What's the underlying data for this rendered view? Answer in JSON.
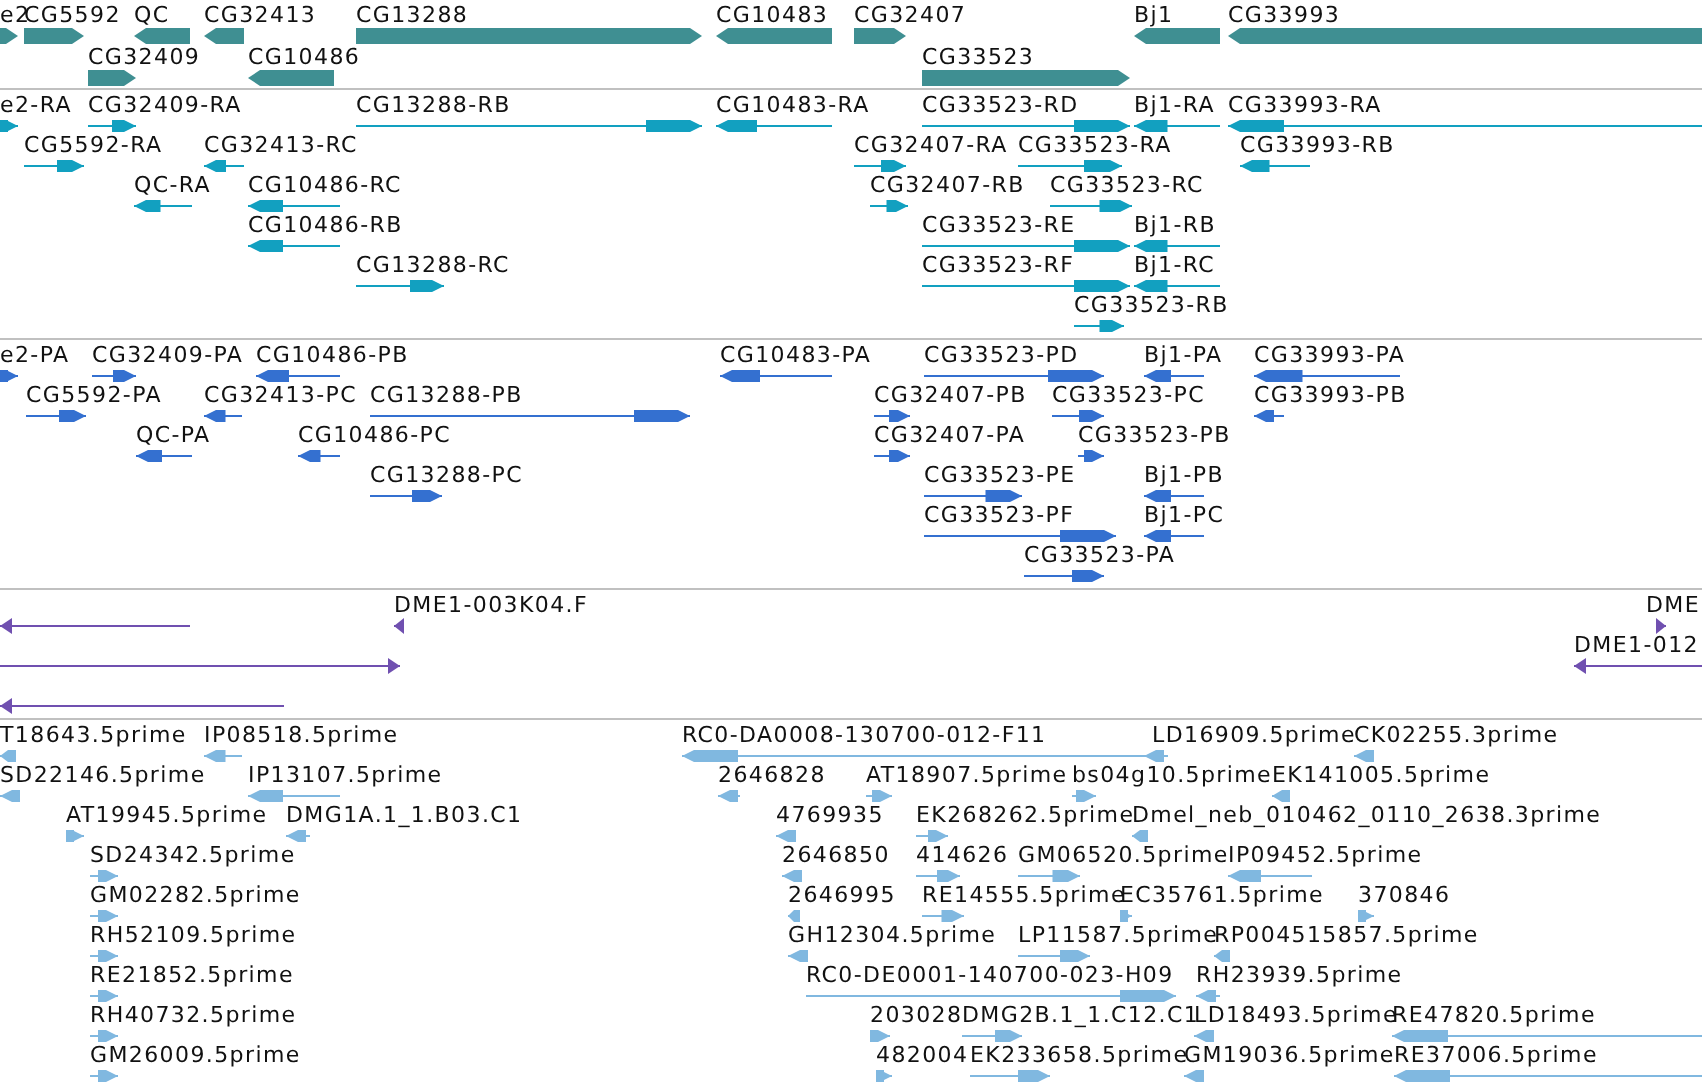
{
  "tracks": [
    {
      "kind": "gene",
      "color": "#3f8f92",
      "features": [
        {
          "label": "e2",
          "reverse": false
        },
        {
          "label": "CG5592",
          "reverse": false
        },
        {
          "label": "QC",
          "reverse": true
        },
        {
          "label": "CG32413",
          "reverse": true
        },
        {
          "label": "CG13288",
          "reverse": false
        },
        {
          "label": "CG10483",
          "reverse": true
        },
        {
          "label": "CG32407",
          "reverse": false
        },
        {
          "label": "Bj1",
          "reverse": true
        },
        {
          "label": "CG33993",
          "reverse": true
        },
        {
          "label": "CG32409",
          "reverse": false
        },
        {
          "label": "CG10486",
          "reverse": true
        },
        {
          "label": "CG33523",
          "reverse": false
        }
      ]
    },
    {
      "kind": "transcript",
      "color": "#12a0c0",
      "features": [
        {
          "label": "e2-RA",
          "reverse": false
        },
        {
          "label": "CG32409-RA",
          "reverse": false
        },
        {
          "label": "CG13288-RB",
          "reverse": false
        },
        {
          "label": "CG10483-RA",
          "reverse": true
        },
        {
          "label": "CG33523-RD",
          "reverse": false
        },
        {
          "label": "Bj1-RA",
          "reverse": true
        },
        {
          "label": "CG33993-RA",
          "reverse": true
        },
        {
          "label": "CG5592-RA",
          "reverse": false
        },
        {
          "label": "CG32413-RC",
          "reverse": true
        },
        {
          "label": "CG32407-RA",
          "reverse": false
        },
        {
          "label": "CG33523-RA",
          "reverse": false
        },
        {
          "label": "CG33993-RB",
          "reverse": true
        },
        {
          "label": "QC-RA",
          "reverse": true
        },
        {
          "label": "CG10486-RC",
          "reverse": true
        },
        {
          "label": "CG32407-RB",
          "reverse": false
        },
        {
          "label": "CG33523-RC",
          "reverse": false
        },
        {
          "label": "CG10486-RB",
          "reverse": true
        },
        {
          "label": "CG33523-RE",
          "reverse": false
        },
        {
          "label": "Bj1-RB",
          "reverse": true
        },
        {
          "label": "CG13288-RC",
          "reverse": false
        },
        {
          "label": "CG33523-RF",
          "reverse": false
        },
        {
          "label": "Bj1-RC",
          "reverse": true
        },
        {
          "label": "CG33523-RB",
          "reverse": false
        }
      ]
    },
    {
      "kind": "transcript",
      "color": "#3470d0",
      "features": [
        {
          "label": "e2-PA",
          "reverse": false
        },
        {
          "label": "CG32409-PA",
          "reverse": false
        },
        {
          "label": "CG10486-PB",
          "reverse": true
        },
        {
          "label": "CG10483-PA",
          "reverse": true
        },
        {
          "label": "CG33523-PD",
          "reverse": false
        },
        {
          "label": "Bj1-PA",
          "reverse": true
        },
        {
          "label": "CG33993-PA",
          "reverse": true
        },
        {
          "label": "CG5592-PA",
          "reverse": false
        },
        {
          "label": "CG32413-PC",
          "reverse": true
        },
        {
          "label": "CG13288-PB",
          "reverse": false
        },
        {
          "label": "CG32407-PB",
          "reverse": false
        },
        {
          "label": "CG33523-PC",
          "reverse": false
        },
        {
          "label": "CG33993-PB",
          "reverse": true
        },
        {
          "label": "QC-PA",
          "reverse": true
        },
        {
          "label": "CG10486-PC",
          "reverse": true
        },
        {
          "label": "CG32407-PA",
          "reverse": false
        },
        {
          "label": "CG33523-PB",
          "reverse": false
        },
        {
          "label": "CG13288-PC",
          "reverse": false
        },
        {
          "label": "CG33523-PE",
          "reverse": false
        },
        {
          "label": "Bj1-PB",
          "reverse": true
        },
        {
          "label": "CG33523-PF",
          "reverse": false
        },
        {
          "label": "Bj1-PC",
          "reverse": true
        },
        {
          "label": "CG33523-PA",
          "reverse": false
        }
      ]
    },
    {
      "kind": "clone",
      "color": "#7050b0",
      "features": [
        {
          "reverse": true
        },
        {
          "label": "DME1-003K04.F",
          "reverse": true
        },
        {
          "label": "DME",
          "reverse": false
        },
        {
          "reverse": false
        },
        {
          "label": "DME1-012",
          "reverse": true
        },
        {
          "reverse": true
        }
      ]
    },
    {
      "kind": "est",
      "color": "#80b8e0",
      "features": [
        {
          "label": "T18643.5prime",
          "reverse": true
        },
        {
          "label": "IP08518.5prime",
          "reverse": true
        },
        {
          "label": "RC0-DA0008-130700-012-F11",
          "reverse": true
        },
        {
          "label": "LD16909.5prime",
          "reverse": true
        },
        {
          "label": "CK02255.3prime",
          "reverse": true
        },
        {
          "label": "SD22146.5prime",
          "reverse": true
        },
        {
          "label": "IP13107.5prime",
          "reverse": true
        },
        {
          "label": "2646828",
          "reverse": true
        },
        {
          "label": "AT18907.5prime",
          "reverse": false
        },
        {
          "label": "bs04g10.5prime",
          "reverse": false
        },
        {
          "label": "EK141005.5prime",
          "reverse": true
        },
        {
          "label": "AT19945.5prime",
          "reverse": false
        },
        {
          "label": "DMG1A.1_1.B03.C1",
          "reverse": true
        },
        {
          "label": "4769935",
          "reverse": true
        },
        {
          "label": "EK268262.5prime",
          "reverse": false
        },
        {
          "label": "Dmel_neb_010462_0110_2638.3prime",
          "reverse": true
        },
        {
          "label": "SD24342.5prime",
          "reverse": false
        },
        {
          "label": "2646850",
          "reverse": true
        },
        {
          "label": "414626",
          "reverse": false
        },
        {
          "label": "GM06520.5prime",
          "reverse": false
        },
        {
          "label": "IP09452.5prime",
          "reverse": true
        },
        {
          "label": "GM02282.5prime",
          "reverse": false
        },
        {
          "label": "2646995",
          "reverse": true
        },
        {
          "label": "RE14555.5prime",
          "reverse": false
        },
        {
          "label": "EC35761.5prime",
          "reverse": false
        },
        {
          "label": "370846",
          "reverse": false
        },
        {
          "label": "RH52109.5prime",
          "reverse": false
        },
        {
          "label": "GH12304.5prime",
          "reverse": true
        },
        {
          "label": "LP11587.5prime",
          "reverse": false
        },
        {
          "label": "RP004515857.5prime",
          "reverse": true
        },
        {
          "label": "RE21852.5prime",
          "reverse": false
        },
        {
          "label": "RC0-DE0001-140700-023-H09",
          "reverse": false
        },
        {
          "label": "RH23939.5prime",
          "reverse": true
        },
        {
          "label": "RH40732.5prime",
          "reverse": false
        },
        {
          "label": "203028",
          "reverse": false
        },
        {
          "label": "DMG2B.1_1.C12.C1",
          "reverse": false
        },
        {
          "label": "LD18493.5prime",
          "reverse": true
        },
        {
          "label": "RE47820.5prime",
          "reverse": true
        },
        {
          "label": "GM26009.5prime",
          "reverse": false
        },
        {
          "label": "482004",
          "reverse": false
        },
        {
          "label": "EK233658.5prime",
          "reverse": false
        },
        {
          "label": "GM19036.5prime",
          "reverse": true
        },
        {
          "label": "RE37006.5prime",
          "reverse": true
        }
      ]
    }
  ]
}
